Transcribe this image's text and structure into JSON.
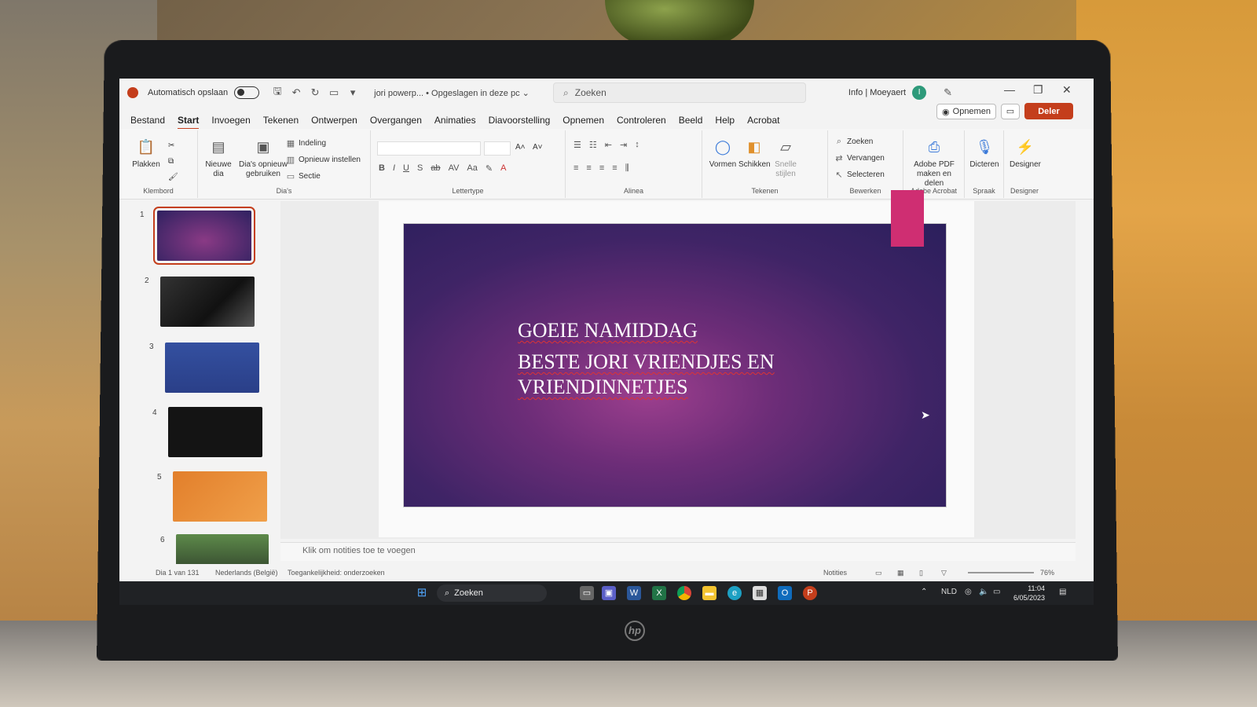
{
  "titlebar": {
    "autosave_label": "Automatisch opslaan",
    "document_title": "jori powerp... • Opgeslagen in deze pc ⌄",
    "search_placeholder": "Zoeken",
    "user_label": "Info | Moeyaert",
    "avatar_initial": "I",
    "minimize": "—",
    "restore": "❐",
    "close": "✕"
  },
  "tabs": [
    {
      "label": "Bestand"
    },
    {
      "label": "Start"
    },
    {
      "label": "Invoegen"
    },
    {
      "label": "Tekenen"
    },
    {
      "label": "Ontwerpen"
    },
    {
      "label": "Overgangen"
    },
    {
      "label": "Animaties"
    },
    {
      "label": "Diavoorstelling"
    },
    {
      "label": "Opnemen"
    },
    {
      "label": "Controleren"
    },
    {
      "label": "Beeld"
    },
    {
      "label": "Help"
    },
    {
      "label": "Acrobat"
    }
  ],
  "actions": {
    "open_label": "Opnemen",
    "share_label": "Deler"
  },
  "ribbon": {
    "clipboard": {
      "paste": "Plakken",
      "group": "Klembord"
    },
    "slides": {
      "new_slide": "Nieuwe dia",
      "reuse": "Dia's opnieuw gebruiken",
      "layout": "Indeling",
      "reset": "Opnieuw instellen",
      "section": "Sectie",
      "group": "Dia's"
    },
    "font": {
      "group": "Lettertype"
    },
    "paragraph": {
      "group": "Alinea"
    },
    "drawing": {
      "shapes": "Vormen",
      "arrange": "Schikken",
      "quick_styles": "Snelle stijlen",
      "group": "Tekenen"
    },
    "editing": {
      "find": "Zoeken",
      "replace": "Vervangen",
      "select": "Selecteren",
      "group": "Bewerken"
    },
    "acrobat": {
      "pdf": "Adobe PDF maken en delen",
      "group": "Adobe Acrobat"
    },
    "voice": {
      "dictate": "Dicteren",
      "group": "Spraak"
    },
    "designer": {
      "label": "Designer",
      "group": "Designer"
    }
  },
  "slides": [
    {
      "number": "1"
    },
    {
      "number": "2"
    },
    {
      "number": "3"
    },
    {
      "number": "4"
    },
    {
      "number": "5"
    },
    {
      "number": "6"
    }
  ],
  "current_slide": {
    "line1": "GOEIE NAMIDDAG",
    "line2": "BESTE JORI VRIENDJES EN",
    "line3": "VRIENDINNETJES"
  },
  "notes_placeholder": "Klik om notities toe te voegen",
  "statusbar": {
    "slide_count": "Dia 1 van 131",
    "language": "Nederlands (België)",
    "accessibility": "Toegankelijkheid: onderzoeken",
    "notes_button": "Notities",
    "zoom": "76%"
  },
  "taskbar": {
    "search_label": "Zoeken",
    "language": "NLD",
    "time": "11:04",
    "date": "6/05/2023"
  },
  "colors": {
    "accent": "#c43e1c",
    "slide_tag": "#cf2e72"
  }
}
